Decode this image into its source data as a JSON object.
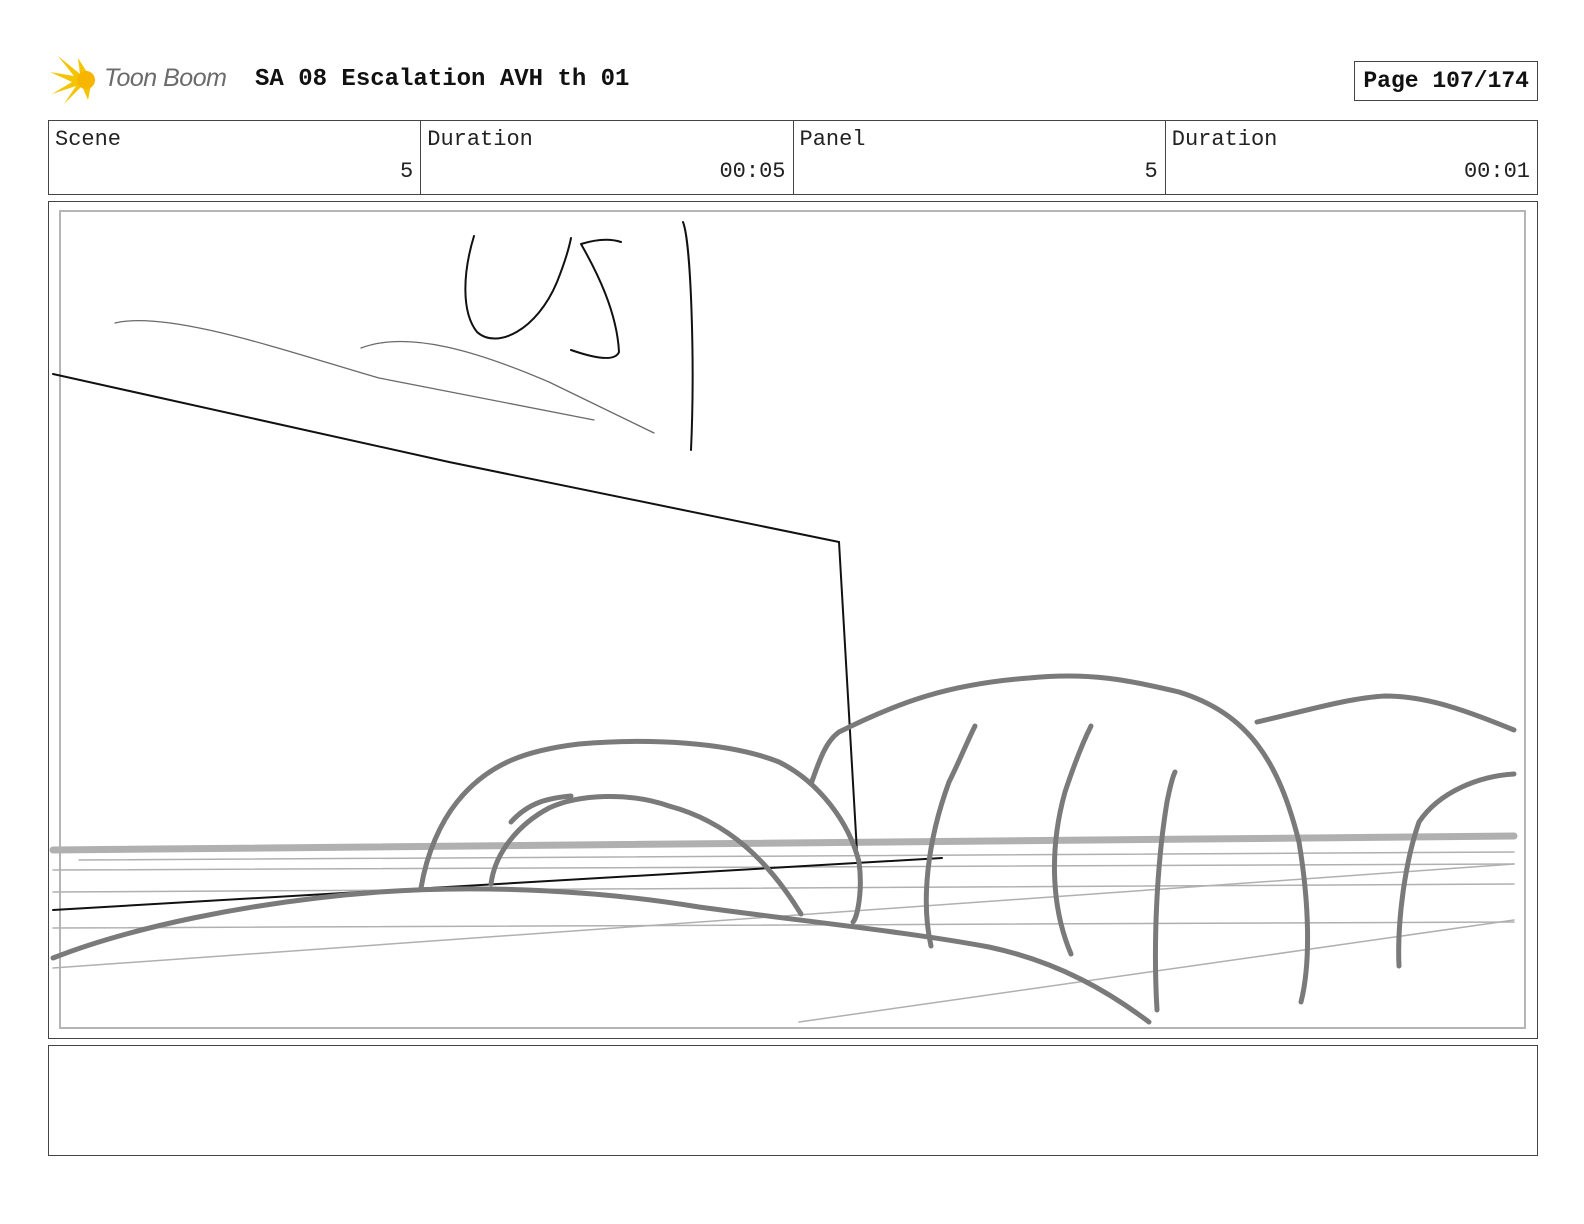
{
  "header": {
    "logo_text": "Toon Boom",
    "logo_icon": "starburst-logo-icon",
    "title": "SA 08 Escalation AVH th 01",
    "page_label": "Page 107/174"
  },
  "info": {
    "scene_label": "Scene",
    "scene_value": "5",
    "scene_duration_label": "Duration",
    "scene_duration_value": "00:05",
    "panel_label": "Panel",
    "panel_value": "5",
    "panel_duration_label": "Duration",
    "panel_duration_value": "00:01"
  },
  "panel": {
    "sketch_text": "US"
  },
  "notes": {
    "text": ""
  },
  "colors": {
    "logo_yellow": "#f5c400",
    "sketch_black": "#111111",
    "sketch_gray": "#7a7a7a",
    "sketch_light_gray": "#b0b0b0"
  }
}
